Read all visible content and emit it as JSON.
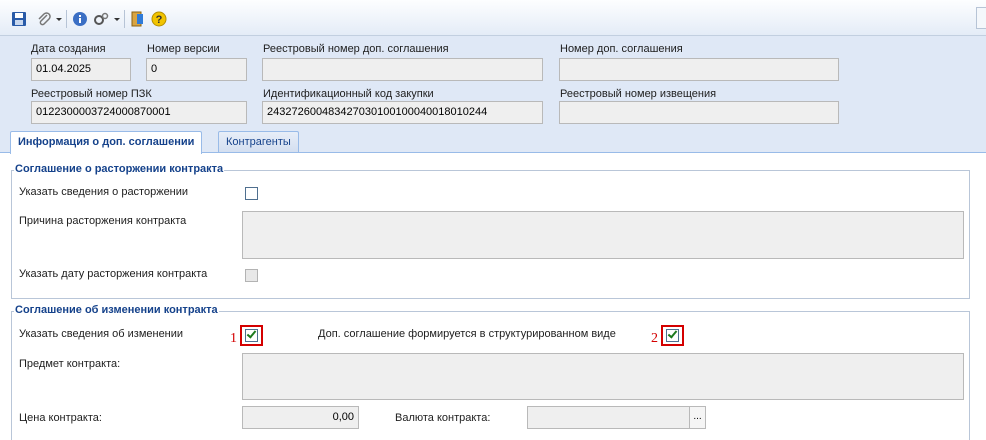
{
  "toolbar": {
    "icons": [
      "save-icon",
      "attach-icon",
      "info-icon",
      "settings-icon",
      "exit-icon",
      "help-icon"
    ]
  },
  "header": {
    "creation_date_label": "Дата создания",
    "creation_date_value": "01.04.2025",
    "version_label": "Номер версии",
    "version_value": "0",
    "registry_number_label": "Реестровый номер доп. соглашения",
    "registry_number_value": "",
    "agreement_number_label": "Номер доп. соглашения",
    "agreement_number_value": "",
    "pzk_label": "Реестровый номер ПЗК",
    "pzk_value": "0122300003724000870001",
    "ikz_label": "Идентификационный код закупки",
    "ikz_value": "243272600483427030100100040018010244",
    "notice_label": "Реестровый номер извещения",
    "notice_value": ""
  },
  "tabs": [
    {
      "label": "Информация о доп. соглашении",
      "active": true
    },
    {
      "label": "Контрагенты",
      "active": false
    }
  ],
  "termination": {
    "title": "Соглашение о расторжении контракта",
    "specify_label": "Указать сведения о расторжении",
    "specify_checked": false,
    "reason_label": "Причина расторжения контракта",
    "reason_value": "",
    "date_label": "Указать дату расторжения контракта",
    "date_checked": false
  },
  "change": {
    "title": "Соглашение об изменении контракта",
    "specify_label": "Указать сведения об изменении",
    "specify_checked": true,
    "structured_label": "Доп. соглашение формируется в структурированном виде",
    "structured_checked": true,
    "subject_label": "Предмет контракта:",
    "subject_value": "",
    "price_label": "Цена контракта:",
    "price_value": "0,00",
    "currency_label": "Валюта контракта:",
    "currency_value": "",
    "currency_button": "..."
  },
  "annotations": {
    "callout_1": "1",
    "callout_2": "2"
  },
  "colors": {
    "header_bg": "#dfe8f6",
    "group_title": "#15428b",
    "highlight": "#d40000",
    "check": "#1d7a1d"
  }
}
